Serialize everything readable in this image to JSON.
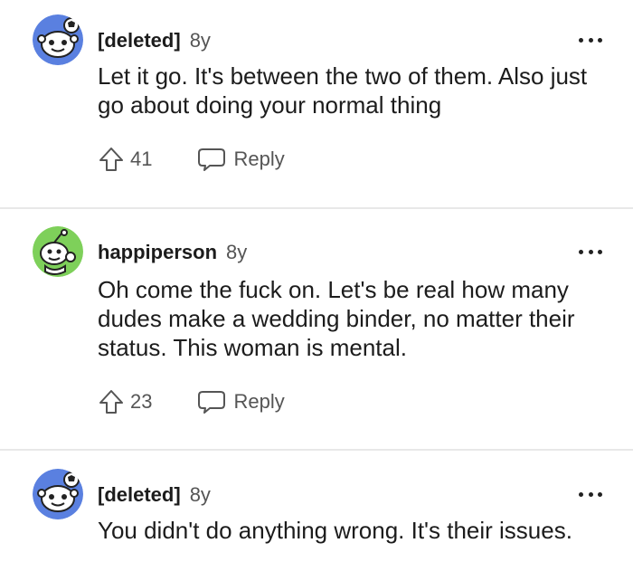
{
  "comments": [
    {
      "username": "[deleted]",
      "age": "8y",
      "text": "Let it go. It's between the two of them. Also just go about doing your normal thing",
      "votes": "41",
      "reply_label": "Reply",
      "avatar_icon": "deleted-user-avatar-icon"
    },
    {
      "username": "happiperson",
      "age": "8y",
      "text": "Oh come the fuck on. Let's be real how many dudes make a wedding binder, no matter their status. This woman is mental.",
      "votes": "23",
      "reply_label": "Reply",
      "avatar_icon": "snoo-green-avatar-icon"
    },
    {
      "username": "[deleted]",
      "age": "8y",
      "text": "You didn't do anything wrong. It's their issues.",
      "avatar_icon": "deleted-user-avatar-icon"
    }
  ],
  "colors": {
    "avatar_blue": "#5a80e0",
    "avatar_green": "#7ed05a",
    "divider": "#e8e8e8",
    "muted_text": "#555555"
  }
}
